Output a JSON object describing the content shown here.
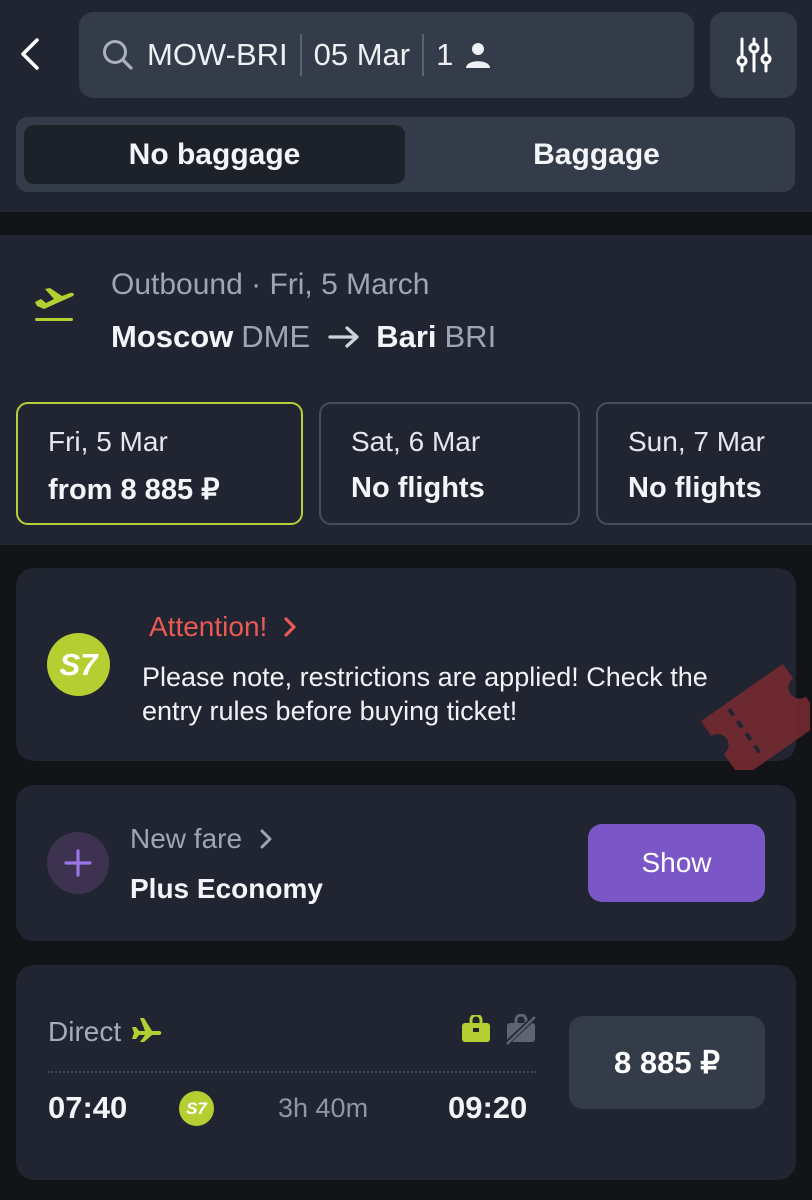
{
  "search": {
    "route": "MOW-BRI",
    "date": "05 Mar",
    "passengers": "1"
  },
  "baggage_toggle": {
    "options": [
      {
        "label": "No baggage",
        "selected": true
      },
      {
        "label": "Baggage",
        "selected": false
      }
    ]
  },
  "outbound": {
    "title": "Outbound · Fri, 5 March",
    "origin_city": "Moscow",
    "origin_code": "DME",
    "dest_city": "Bari",
    "dest_code": "BRI"
  },
  "dates": [
    {
      "day": "Fri, 5 Mar",
      "price": "from 8 885 ₽",
      "selected": true
    },
    {
      "day": "Sat, 6 Mar",
      "price": "No flights",
      "selected": false
    },
    {
      "day": "Sun, 7 Mar",
      "price": "No flights",
      "selected": false
    }
  ],
  "attention": {
    "title": "Attention!",
    "text": " Please note, restrictions are applied! Check the entry rules before buying ticket!",
    "logo_text": "S7"
  },
  "fare": {
    "label": "New fare",
    "name": "Plus Economy",
    "button": "Show"
  },
  "flight": {
    "type": "Direct",
    "departure": "07:40",
    "duration": "3h 40m",
    "arrival": "09:20",
    "airline_logo": "S7",
    "price": "8 885 ₽"
  },
  "colors": {
    "accent_green": "#b5cf32",
    "alert_red": "#e85b55",
    "purple": "#7b56c7"
  },
  "icons": [
    "back-chevron-icon",
    "search-icon",
    "person-icon",
    "filter-sliders-icon",
    "plane-departure-icon",
    "arrow-right-icon",
    "plane-icon",
    "bag-icon",
    "no-bag-icon",
    "chevron-right-icon",
    "plus-icon"
  ]
}
